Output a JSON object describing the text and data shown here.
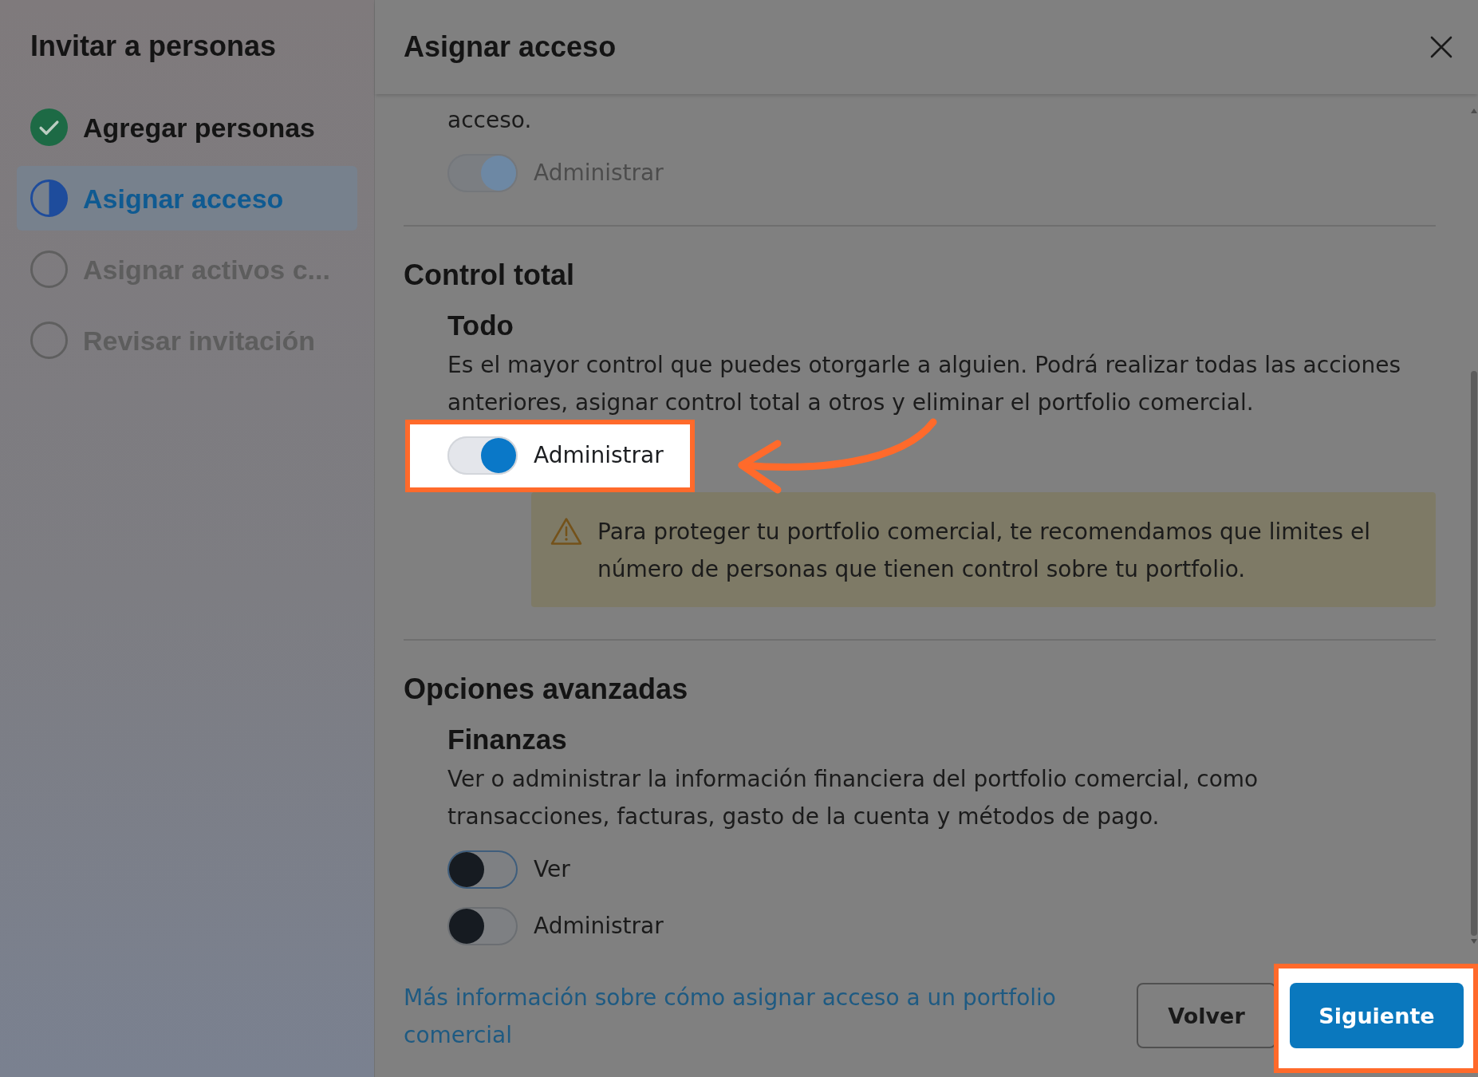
{
  "sidebar": {
    "title": "Invitar a personas",
    "steps": [
      {
        "label": "Agregar personas",
        "completed": true,
        "selected": false
      },
      {
        "label": "Asignar acceso",
        "completed": false,
        "selected": true
      },
      {
        "label": "Asignar activos c...",
        "completed": false,
        "selected": false
      },
      {
        "label": "Revisar invitación",
        "completed": false,
        "selected": false
      }
    ]
  },
  "dialog": {
    "title": "Asignar acceso",
    "sections": [
      {
        "groups": [
          {
            "description": "acceso.",
            "toggles": [
              {
                "label": "Administrar",
                "on": true,
                "disabled": true,
                "focused": false,
                "highlighted": false
              }
            ]
          }
        ]
      },
      {
        "heading": "Control total",
        "groups": [
          {
            "title": "Todo",
            "description": "Es el mayor control que puedes otorgarle a alguien. Podrá realizar todas las acciones anteriores, asignar control total a otros y eliminar el portfolio comercial.",
            "toggles": [
              {
                "label": "Administrar",
                "on": true,
                "disabled": false,
                "focused": false,
                "highlighted": true,
                "arrow": true
              }
            ],
            "warning": "Para proteger tu portfolio comercial, te recomendamos que limites el número de personas que tienen control sobre tu portfolio."
          }
        ]
      },
      {
        "heading": "Opciones avanzadas",
        "groups": [
          {
            "title": "Finanzas",
            "description": "Ver o administrar la información financiera del portfolio comercial, como transacciones, facturas, gasto de la cuenta y métodos de pago.",
            "toggles": [
              {
                "label": "Ver",
                "on": false,
                "disabled": false,
                "focused": true,
                "highlighted": false
              },
              {
                "label": "Administrar",
                "on": false,
                "disabled": false,
                "focused": false,
                "highlighted": false
              }
            ]
          }
        ]
      }
    ],
    "footer": {
      "link": "Más información sobre cómo asignar acceso a un portfolio comercial",
      "buttons": [
        {
          "label": "Volver",
          "kind": "secondary",
          "highlighted": false
        },
        {
          "label": "Siguiente",
          "kind": "primary",
          "highlighted": true
        }
      ]
    }
  }
}
